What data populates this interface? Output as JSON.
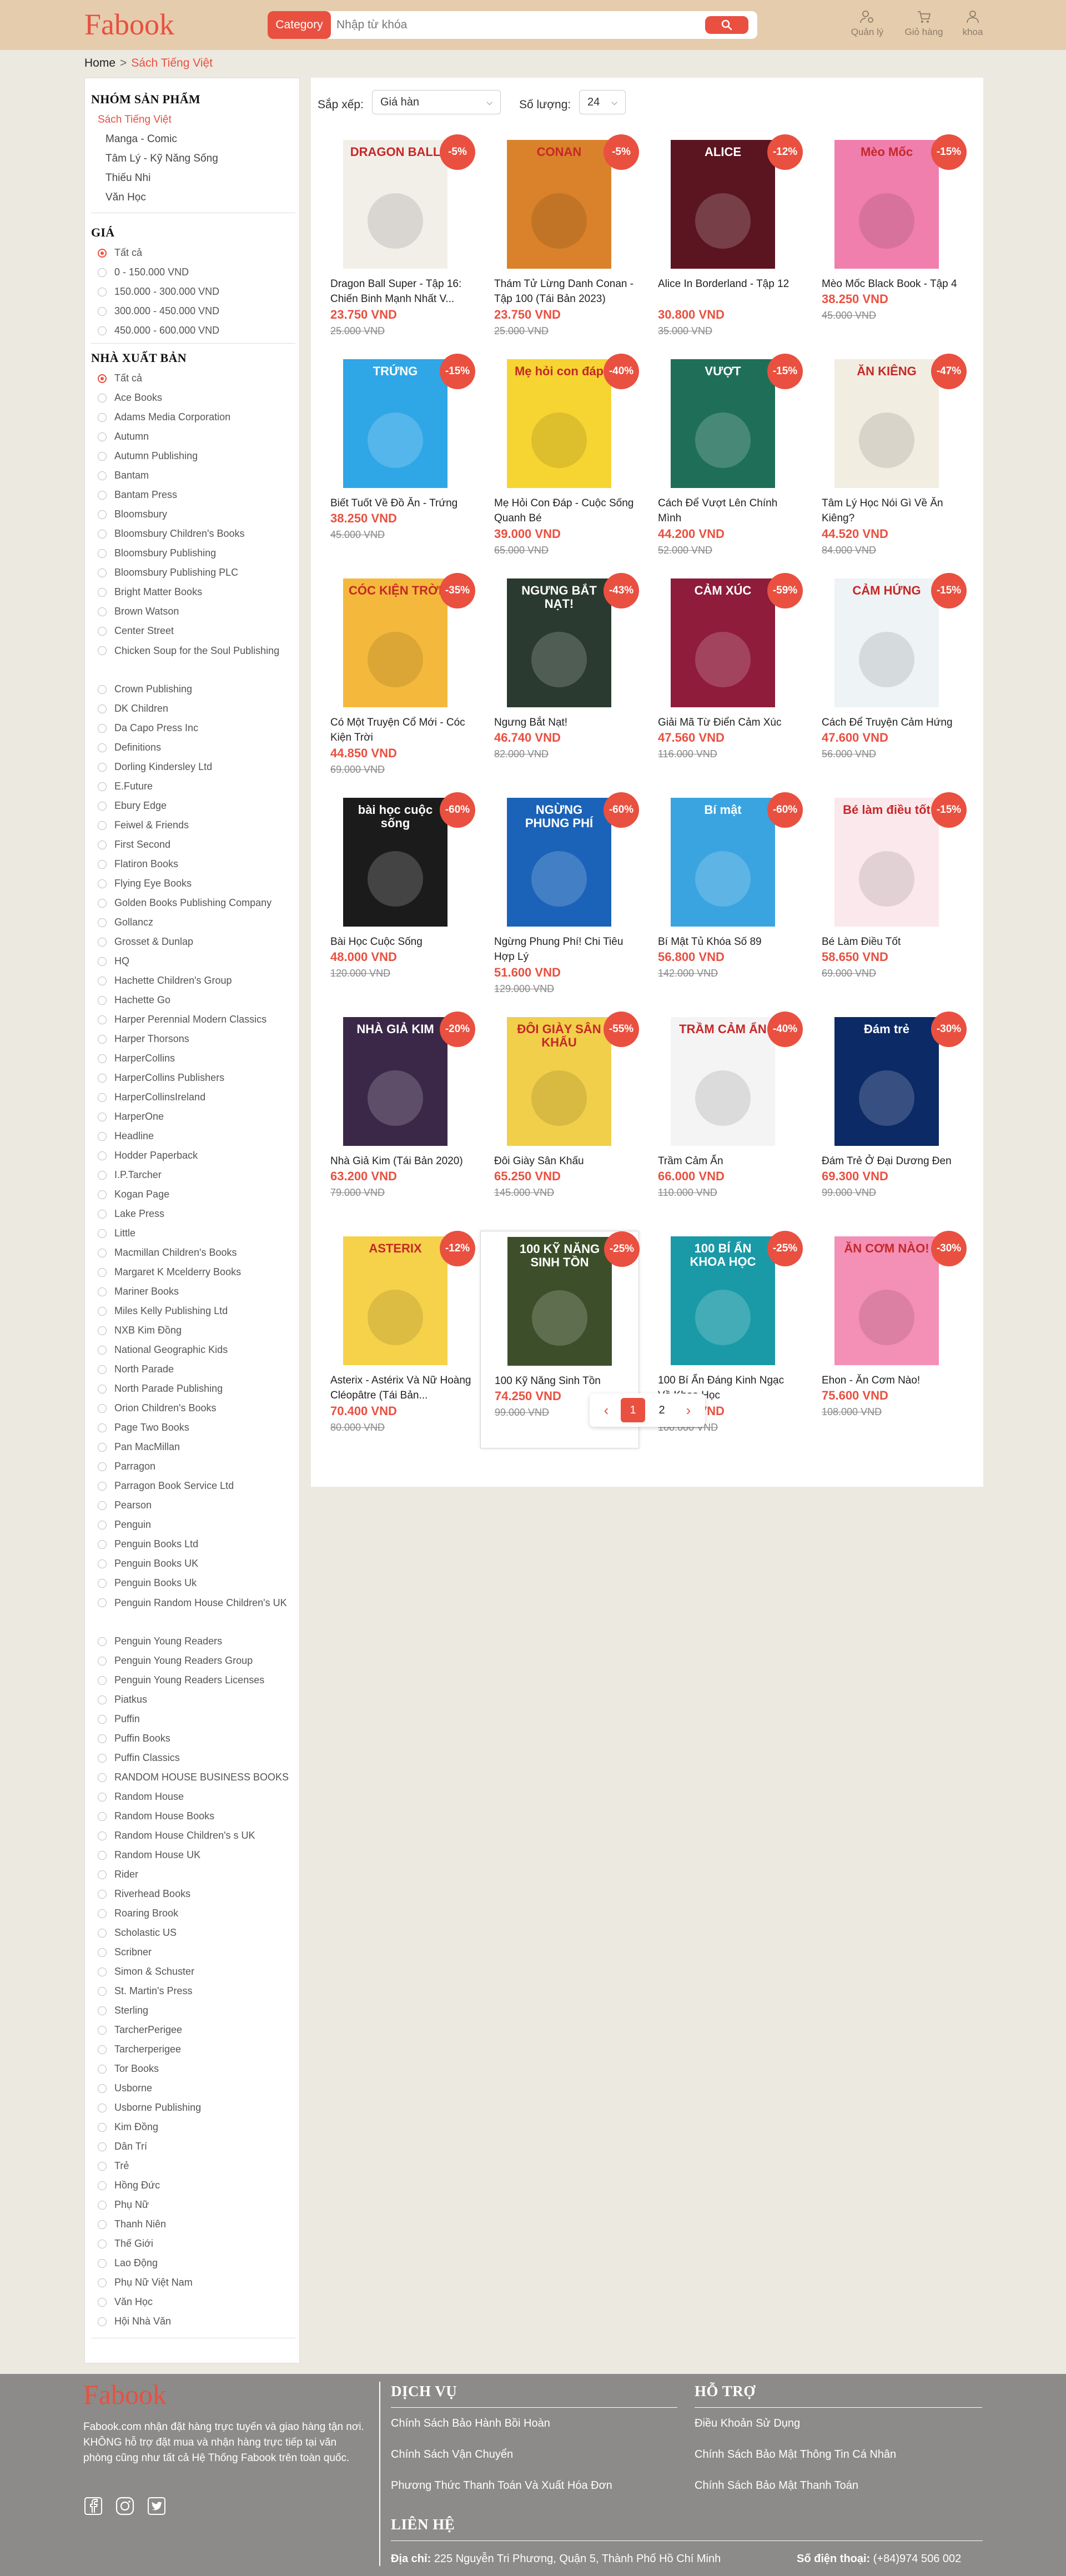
{
  "header": {
    "logo": "Fabook",
    "category_button": "Category",
    "search_placeholder": "Nhập từ khóa",
    "manage_label": "Quản lý",
    "cart_label": "Giỏ hàng",
    "account_label": "khoa"
  },
  "breadcrumb": {
    "home": "Home",
    "separator": ">",
    "current": "Sách Tiếng Việt"
  },
  "sidebar": {
    "group_title": "NHÓM SẢN PHẨM",
    "categories": [
      "Sách Tiếng Việt",
      "Manga - Comic",
      "Tâm Lý - Kỹ Năng Sống",
      "Thiếu Nhi",
      "Văn Học"
    ],
    "price_title": "GIÁ",
    "prices": [
      "Tất cả",
      "0 - 150.000 VND",
      "150.000 - 300.000 VND",
      "300.000 - 450.000 VND",
      "450.000 - 600.000 VND"
    ],
    "publisher_title": "NHÀ XUẤT BẢN",
    "publishers": [
      "Tất cả",
      "Ace Books",
      "Adams Media Corporation",
      "Autumn",
      "Autumn Publishing",
      "Bantam",
      "Bantam Press",
      "Bloomsbury",
      "Bloomsbury Children's Books",
      "Bloomsbury Publishing",
      "Bloomsbury Publishing PLC",
      "Bright Matter Books",
      "Brown Watson",
      "Center Street",
      "Chicken Soup for the Soul Publishing",
      "Crown Publishing",
      "DK Children",
      "Da Capo Press Inc",
      "Definitions",
      "Dorling Kindersley Ltd",
      "E.Future",
      "Ebury Edge",
      "Feiwel & Friends",
      "First Second",
      "Flatiron Books",
      "Flying Eye Books",
      "Golden Books Publishing Company",
      "Gollancz",
      "Grosset & Dunlap",
      "HQ",
      "Hachette Children's Group",
      "Hachette Go",
      "Harper Perennial Modern Classics",
      "Harper Thorsons",
      "HarperCollins",
      "HarperCollins Publishers",
      "HarperCollinsIreland",
      "HarperOne",
      "Headline",
      "Hodder Paperback",
      "I.P.Tarcher",
      "Kogan Page",
      "Lake Press",
      "Little",
      "Macmillan Children's Books",
      "Margaret K Mcelderry Books",
      "Mariner Books",
      "Miles Kelly Publishing Ltd",
      "NXB Kim Đồng",
      "National Geographic Kids",
      "North Parade",
      "North Parade Publishing",
      "Orion Children's Books",
      "Page Two Books",
      "Pan MacMillan",
      "Parragon",
      "Parragon Book Service Ltd",
      "Pearson",
      "Penguin",
      "Penguin Books Ltd",
      "Penguin Books UK",
      "Penguin Books Uk",
      "Penguin Random House Children's UK",
      "Penguin Young Readers",
      "Penguin Young Readers Group",
      "Penguin Young Readers Licenses",
      "Piatkus",
      "Puffin",
      "Puffin Books",
      "Puffin Classics",
      "RANDOM HOUSE BUSINESS BOOKS",
      "Random House",
      "Random House Books",
      "Random House Children's s UK",
      "Random House UK",
      "Rider",
      "Riverhead Books",
      "Roaring Brook",
      "Scholastic US",
      "Scribner",
      "Simon & Schuster",
      "St. Martin's Press",
      "Sterling",
      "TarcherPerigee",
      "Tarcherperigee",
      "Tor Books",
      "Usborne",
      "Usborne Publishing",
      "Kim Đồng",
      "Dân Trí",
      "Trẻ",
      "Hồng Đức",
      "Phụ Nữ",
      "Thanh Niên",
      "Thế Giới",
      "Lao Động",
      "Phụ Nữ Việt Nam",
      "Văn Học",
      "Hội Nhà Văn"
    ]
  },
  "controls": {
    "sort_label": "Sắp xếp:",
    "sort_value": "Giá hàn",
    "count_label": "Số lượng:",
    "count_value": "24"
  },
  "products": [
    {
      "name": "Dragon Ball Super - Tập 16: Chiến Binh Mạnh Nhất V...",
      "price": "23.750 VND",
      "old": "25.000 VND",
      "discount": "-5%",
      "cover_color": "#f2efe9",
      "cover_title": "DRAGON BALL"
    },
    {
      "name": "Thám Tử Lừng Danh Conan - Tập 100 (Tái Bản 2023)",
      "price": "23.750 VND",
      "old": "25.000 VND",
      "discount": "-5%",
      "cover_color": "#d9822b",
      "cover_title": "CONAN"
    },
    {
      "name": "Alice In Borderland - Tập 12",
      "price": "30.800 VND",
      "old": "35.000 VND",
      "discount": "-12%",
      "cover_color": "#5a1520",
      "cover_title": "ALICE"
    },
    {
      "name": "Mèo Mốc Black Book - Tập 4",
      "price": "38.250 VND",
      "old": "45.000 VND",
      "discount": "-15%",
      "cover_color": "#f07fae",
      "cover_title": "Mèo Mốc"
    },
    {
      "name": "Biết Tuốt Về Đồ Ăn - Trứng",
      "price": "38.250 VND",
      "old": "45.000 VND",
      "discount": "-15%",
      "cover_color": "#2fa6e6",
      "cover_title": "TRỨNG"
    },
    {
      "name": "Mẹ Hỏi Con Đáp - Cuộc Sống Quanh Bé",
      "price": "39.000 VND",
      "old": "65.000 VND",
      "discount": "-40%",
      "cover_color": "#f6d432",
      "cover_title": "Mẹ hỏi con đáp"
    },
    {
      "name": "Cách Để Vượt Lên Chính Mình",
      "price": "44.200 VND",
      "old": "52.000 VND",
      "discount": "-15%",
      "cover_color": "#1f6f58",
      "cover_title": "VƯỢT"
    },
    {
      "name": "Tâm Lý Học Nói Gì Về Ăn Kiêng?",
      "price": "44.520 VND",
      "old": "84.000 VND",
      "discount": "-47%",
      "cover_color": "#f2ede1",
      "cover_title": "ĂN KIÊNG"
    },
    {
      "name": "Có Một Truyện Cổ Mới - Cóc Kiện Trời",
      "price": "44.850 VND",
      "old": "69.000 VND",
      "discount": "-35%",
      "cover_color": "#f4b93c",
      "cover_title": "CÓC KIỆN TRỜI"
    },
    {
      "name": "Ngưng Bắt Nạt!",
      "price": "46.740 VND",
      "old": "82.000 VND",
      "discount": "-43%",
      "cover_color": "#2a3a30",
      "cover_title": "NGƯNG BẮT NẠT!"
    },
    {
      "name": "Giải Mã Từ Điển Cảm Xúc",
      "price": "47.560 VND",
      "old": "116.000 VND",
      "discount": "-59%",
      "cover_color": "#8e1c3a",
      "cover_title": "CẢM XÚC"
    },
    {
      "name": "Cách Để Truyện Cảm Hứng",
      "price": "47.600 VND",
      "old": "56.000 VND",
      "discount": "-15%",
      "cover_color": "#eef3f5",
      "cover_title": "CẢM HỨNG"
    },
    {
      "name": "Bài Học Cuộc Sống",
      "price": "48.000 VND",
      "old": "120.000 VND",
      "discount": "-60%",
      "cover_color": "#1b1b1b",
      "cover_title": "bài học cuộc sống"
    },
    {
      "name": "Ngừng Phung Phí! Chi Tiêu Hợp Lý",
      "price": "51.600 VND",
      "old": "129.000 VND",
      "discount": "-60%",
      "cover_color": "#1a63b8",
      "cover_title": "NGỪNG PHUNG PHÍ"
    },
    {
      "name": "Bí Mật Tủ Khóa Số 89",
      "price": "56.800 VND",
      "old": "142.000 VND",
      "discount": "-60%",
      "cover_color": "#3aa4e0",
      "cover_title": "Bí mật"
    },
    {
      "name": "Bé Làm Điều Tốt",
      "price": "58.650 VND",
      "old": "69.000 VND",
      "discount": "-15%",
      "cover_color": "#fbe8ec",
      "cover_title": "Bé làm điều tốt"
    },
    {
      "name": "Nhà Giả Kim (Tái Bản 2020)",
      "price": "63.200 VND",
      "old": "79.000 VND",
      "discount": "-20%",
      "cover_color": "#3b2848",
      "cover_title": "NHÀ GIẢ KIM"
    },
    {
      "name": "Đôi Giày Sân Khấu",
      "price": "65.250 VND",
      "old": "145.000 VND",
      "discount": "-55%",
      "cover_color": "#f1cf4a",
      "cover_title": "ĐÔI GIÀY SÂN KHẤU"
    },
    {
      "name": "Trầm Cảm Ẩn",
      "price": "66.000 VND",
      "old": "110.000 VND",
      "discount": "-40%",
      "cover_color": "#f4f4f4",
      "cover_title": "TRẦM CẢM ẨN"
    },
    {
      "name": "Đám Trẻ Ở Đại Dương Đen",
      "price": "69.300 VND",
      "old": "99.000 VND",
      "discount": "-30%",
      "cover_color": "#0b2a66",
      "cover_title": "Đám trẻ"
    },
    {
      "name": "Asterix - Astérix Và Nữ Hoàng Cléopâtre (Tái Bản...",
      "price": "70.400 VND",
      "old": "80.000 VND",
      "discount": "-12%",
      "cover_color": "#f5d24a",
      "cover_title": "ASTERIX"
    },
    {
      "name": "100 Kỹ Năng Sinh Tồn",
      "price": "74.250 VND",
      "old": "99.000 VND",
      "discount": "-25%",
      "cover_color": "#3d4f2a",
      "cover_title": "100 KỸ NĂNG SINH TỒN"
    },
    {
      "name": "100 Bí Ẩn Đáng Kinh Ngạc Về Khoa Học",
      "price": "75.000 VND",
      "old": "100.000 VND",
      "discount": "-25%",
      "cover_color": "#1a9aa6",
      "cover_title": "100 BÍ ẨN KHOA HỌC"
    },
    {
      "name": "Ehon - Ăn Cơm Nào!",
      "price": "75.600 VND",
      "old": "108.000 VND",
      "discount": "-30%",
      "cover_color": "#f48fb5",
      "cover_title": "ĂN CƠM NÀO!"
    }
  ],
  "pagination": {
    "prev": "‹",
    "pages": [
      "1",
      "2"
    ],
    "current": "1",
    "next": "›"
  },
  "footer": {
    "logo": "Fabook",
    "description": "Fabook.com nhận đặt hàng trực tuyến và giao hàng tận nơi. KHÔNG hỗ trợ đặt mua và nhận hàng trực tiếp tại văn phòng cũng như tất cả Hệ Thống Fabook trên toàn quốc.",
    "service_title": "DỊCH VỤ",
    "service_links": [
      "Chính Sách Bảo Hành Bồi Hoàn",
      "Chính Sách Vận Chuyển",
      "Phương Thức Thanh Toán Và Xuất Hóa Đơn"
    ],
    "support_title": "HỖ TRỢ",
    "support_links": [
      "Điều Khoản Sử Dụng",
      "Chính Sách Bảo Mật Thông Tin Cá Nhân",
      "Chính Sách Bảo Mật Thanh Toán"
    ],
    "contact_title": "LIÊN HỆ",
    "address_label": "Địa chỉ:",
    "address": "225 Nguyễn Tri Phương, Quận 5, Thành Phố Hồ Chí Minh",
    "phone_label": "Số điện thoại:",
    "phone": "(+84)974 506 002"
  },
  "colors": {
    "accent": "#e95040",
    "header_bg": "#e5ccad",
    "page_bg": "#ece9e1",
    "footer_bg": "#8c8b89"
  }
}
